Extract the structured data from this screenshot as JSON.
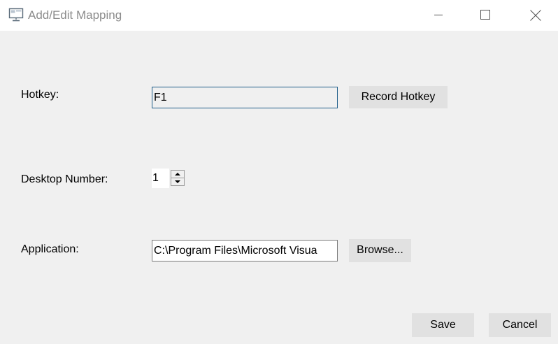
{
  "window": {
    "title": "Add/Edit Mapping",
    "icon": "monitor-icon",
    "controls": [
      "minimize-icon",
      "maximize-icon",
      "close-icon"
    ]
  },
  "form": {
    "hotkey": {
      "label": "Hotkey:",
      "value": "F1",
      "record_button": "Record Hotkey"
    },
    "desktop_number": {
      "label": "Desktop Number:",
      "value": "1"
    },
    "application": {
      "label": "Application:",
      "value": "C:\\Program Files\\Microsoft Visua",
      "browse_button": "Browse..."
    }
  },
  "footer": {
    "save_label": "Save",
    "cancel_label": "Cancel"
  },
  "colors": {
    "background": "#f0f0f0",
    "titlebar": "#ffffff",
    "title_text": "#8c8c8c",
    "button": "#e1e1e1",
    "focus_border": "#1e5d89"
  }
}
